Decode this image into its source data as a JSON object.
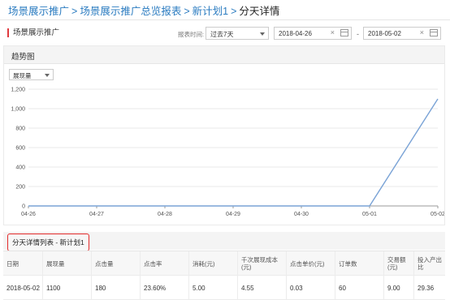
{
  "breadcrumb": {
    "items": [
      "场景展示推广",
      "场景展示推广总览报表",
      "新计划1"
    ],
    "separator": ">",
    "current": "分天详情"
  },
  "section": {
    "title": "场景展示推广",
    "accent_color": "#e0393e"
  },
  "filters": {
    "range_label": "报表时间:",
    "range_value": "过去7天",
    "start_date": "2018-04-26",
    "end_date": "2018-05-02",
    "dash": "-",
    "clear_icon": "×"
  },
  "trend": {
    "title": "趋势图",
    "metric": "展现量"
  },
  "chart_data": {
    "type": "line",
    "categories": [
      "04-26",
      "04-27",
      "04-28",
      "04-29",
      "04-30",
      "05-01",
      "05-02"
    ],
    "series": [
      {
        "values": [
          0,
          0,
          0,
          0,
          0,
          0,
          1100
        ]
      }
    ],
    "ylim": [
      0,
      1200
    ],
    "yticks": [
      "0",
      "200",
      "400",
      "600",
      "800",
      "1,000",
      "1,200"
    ],
    "grid": true,
    "line_color": "#7aa3d6"
  },
  "detail_table": {
    "title": "分天详情列表 - 新计划1",
    "highlight_color": "#e32b2b",
    "columns": [
      "日期",
      "展现量",
      "点击量",
      "点击率",
      "消耗(元)",
      "千次展现成本(元)",
      "点击单价(元)",
      "订单数",
      "交易额(元)",
      "投入产出比"
    ],
    "rows": [
      [
        "2018-05-02",
        "1100",
        "180",
        "23.60%",
        "5.00",
        "4.55",
        "0.03",
        "60",
        "9.00",
        "29.36"
      ]
    ]
  }
}
